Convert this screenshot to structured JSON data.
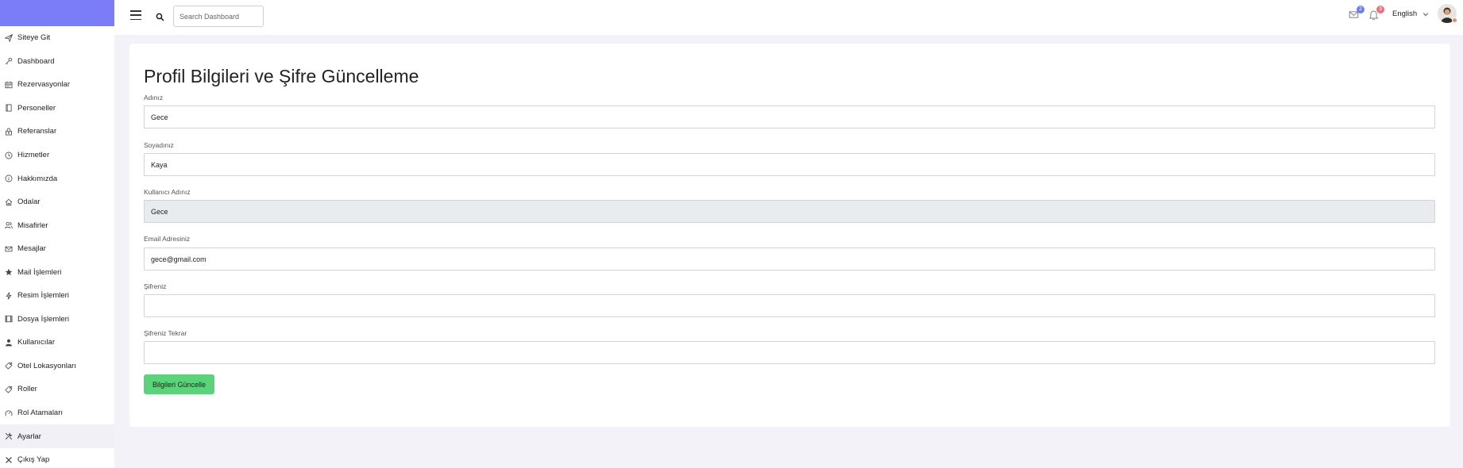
{
  "sidebar": {
    "items": [
      {
        "label": "Siteye Git",
        "icon": "send-icon"
      },
      {
        "label": "Dashboard",
        "icon": "key-icon"
      },
      {
        "label": "Rezervasyonlar",
        "icon": "calendar-icon"
      },
      {
        "label": "Personeller",
        "icon": "book-icon"
      },
      {
        "label": "Referanslar",
        "icon": "lock-icon"
      },
      {
        "label": "Hizmetler",
        "icon": "clock-icon"
      },
      {
        "label": "Hakkımızda",
        "icon": "info-icon"
      },
      {
        "label": "Odalar",
        "icon": "home-icon"
      },
      {
        "label": "Misafirler",
        "icon": "users-icon"
      },
      {
        "label": "Mesajlar",
        "icon": "mail-icon"
      },
      {
        "label": "Mail İşlemleri",
        "icon": "star-icon"
      },
      {
        "label": "Resim İşlemleri",
        "icon": "lightning-icon"
      },
      {
        "label": "Dosya İşlemleri",
        "icon": "film-icon"
      },
      {
        "label": "Kullanıcılar",
        "icon": "user-icon"
      },
      {
        "label": "Otel Lokasyonları",
        "icon": "tag-icon"
      },
      {
        "label": "Roller",
        "icon": "tag-icon"
      },
      {
        "label": "Rol Atamaları",
        "icon": "gauge-icon"
      },
      {
        "label": "Ayarlar",
        "icon": "tools-icon"
      },
      {
        "label": "Çıkış Yap",
        "icon": "close-icon"
      }
    ]
  },
  "header": {
    "search_placeholder": "Search Dashboard",
    "messages_count": "2",
    "notifications_count": "3",
    "language": "English"
  },
  "main": {
    "title": "Profil Bilgileri ve Şifre Güncelleme",
    "fields": [
      {
        "label": "Adınız",
        "value": "Gece",
        "readonly": false
      },
      {
        "label": "Soyadınız",
        "value": "Kaya",
        "readonly": false
      },
      {
        "label": "Kullanıcı Adınız",
        "value": "Gece",
        "readonly": true
      },
      {
        "label": "Email Adresiniz",
        "value": "gece@gmail.com",
        "readonly": false
      },
      {
        "label": "Şifreniz",
        "value": "",
        "readonly": false
      },
      {
        "label": "Şifreniz Tekrar",
        "value": "",
        "readonly": false
      }
    ],
    "submit_label": "Bilgileri Güncelle"
  },
  "colors": {
    "brand": "#7b7cf7",
    "submit": "#5cd37a",
    "badge_blue": "#6c7cf2",
    "badge_red": "#f26c7c"
  }
}
